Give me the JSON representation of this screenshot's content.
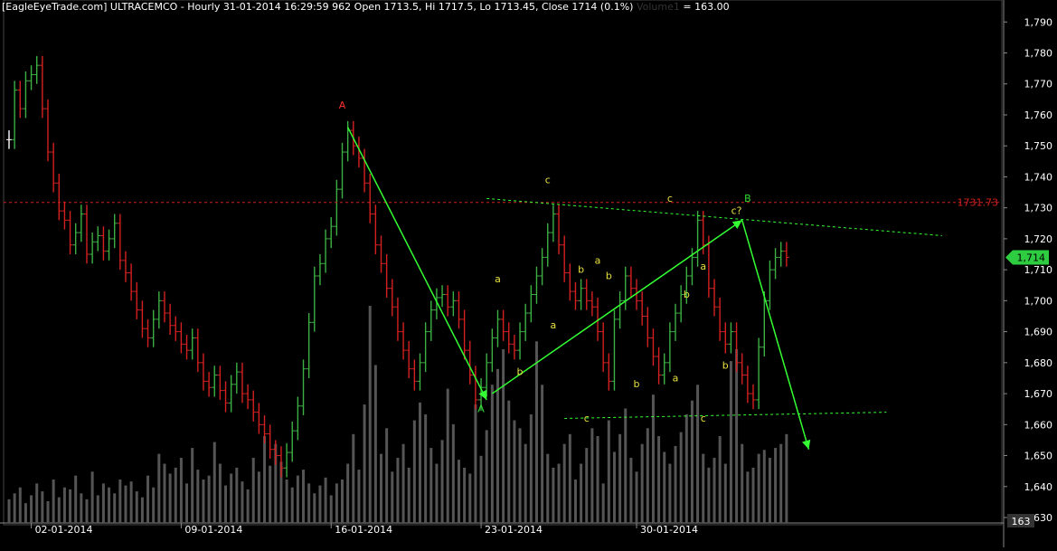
{
  "header": {
    "source": "[EagleEyeTrade.com]",
    "symbol": "ULTRACEMCO",
    "interval": "Hourly",
    "datetime": "31-01-2014 16:29:59 962",
    "ohlc": "Open 1713.5, Hi 1717.5, Lo 1713.45, Close 1714 (0.1%)",
    "volume_label": "Volume1",
    "volume_value": "= 163.00"
  },
  "colors": {
    "background": "#000000",
    "up_bar": "#3cb043",
    "down_bar": "#d42020",
    "neutral_bar": "#ffffff",
    "volume_bar": "#555555",
    "wave_line": "#33ff33",
    "resistance_line": "#d42020",
    "label_yellow": "#e8e040",
    "label_red": "#ff3030",
    "label_green": "#33dd33",
    "axis_text": "#ffffff"
  },
  "chart_data": {
    "type": "line",
    "title": "ULTRACEMCO - Hourly",
    "y_axis_ticks": [
      1790,
      1780,
      1770,
      1760,
      1750,
      1740,
      1730,
      1720,
      1710,
      1700,
      1690,
      1680,
      1670,
      1660,
      1650,
      1640,
      1630
    ],
    "y_tick_labels": [
      "1,790",
      "1,780",
      "1,770",
      "1,760",
      "1,750",
      "1,740",
      "1,730",
      "1,720",
      "1,710",
      "1,700",
      "1,690",
      "1,680",
      "1,670",
      "1,660",
      "1,650",
      "1,640",
      "1,630"
    ],
    "ylim": [
      1630,
      1793
    ],
    "x_tick_labels": [
      "02-01-2014",
      "09-01-2014",
      "16-01-2014",
      "23-01-2014",
      "30-01-2014"
    ],
    "current_price_label": "1,714",
    "volume_label": "163",
    "resistance_level": 1731.73,
    "resistance_label": "1731.73",
    "price_series": [
      1752,
      1768,
      1762,
      1771,
      1773,
      1776,
      1762,
      1748,
      1738,
      1729,
      1726,
      1718,
      1722,
      1728,
      1715,
      1719,
      1721,
      1716,
      1720,
      1725,
      1713,
      1709,
      1703,
      1697,
      1691,
      1688,
      1694,
      1700,
      1696,
      1692,
      1690,
      1686,
      1684,
      1688,
      1680,
      1674,
      1672,
      1676,
      1671,
      1667,
      1673,
      1677,
      1670,
      1668,
      1664,
      1660,
      1657,
      1652,
      1650,
      1646,
      1651,
      1658,
      1666,
      1678,
      1693,
      1708,
      1712,
      1720,
      1724,
      1736,
      1748,
      1755,
      1750,
      1746,
      1738,
      1728,
      1718,
      1712,
      1704,
      1698,
      1690,
      1684,
      1678,
      1674,
      1680,
      1690,
      1697,
      1701,
      1702,
      1698,
      1700,
      1694,
      1684,
      1676,
      1668,
      1672,
      1680,
      1688,
      1694,
      1690,
      1686,
      1684,
      1690,
      1696,
      1702,
      1708,
      1714,
      1722,
      1728,
      1718,
      1709,
      1703,
      1700,
      1704,
      1700,
      1698,
      1690,
      1680,
      1674,
      1694,
      1700,
      1708,
      1704,
      1700,
      1695,
      1688,
      1682,
      1676,
      1680,
      1690,
      1696,
      1702,
      1708,
      1714,
      1726,
      1718,
      1704,
      1698,
      1690,
      1686,
      1690,
      1680,
      1676,
      1670,
      1668,
      1685,
      1700,
      1710,
      1714,
      1716,
      1714
    ],
    "volume_series": [
      12,
      15,
      18,
      10,
      14,
      20,
      16,
      11,
      22,
      13,
      18,
      17,
      24,
      15,
      12,
      26,
      14,
      20,
      18,
      15,
      22,
      19,
      21,
      16,
      13,
      24,
      18,
      35,
      30,
      25,
      28,
      33,
      20,
      38,
      27,
      22,
      24,
      41,
      30,
      19,
      25,
      28,
      21,
      17,
      33,
      26,
      44,
      29,
      40,
      31,
      22,
      18,
      24,
      27,
      20,
      15,
      19,
      23,
      14,
      20,
      22,
      30,
      45,
      27,
      60,
      110,
      80,
      35,
      48,
      26,
      33,
      40,
      28,
      52,
      61,
      55,
      38,
      30,
      42,
      68,
      50,
      32,
      28,
      25,
      60,
      34,
      47,
      70,
      78,
      88,
      62,
      52,
      48,
      40,
      55,
      92,
      70,
      35,
      28,
      30,
      40,
      45,
      22,
      30,
      38,
      48,
      44,
      20,
      52,
      36,
      45,
      58,
      33,
      26,
      40,
      48,
      65,
      44,
      36,
      30,
      39,
      46,
      55,
      62,
      70,
      35,
      28,
      33,
      44,
      30,
      82,
      88,
      40,
      26,
      28,
      35,
      37,
      33,
      38,
      40,
      45
    ],
    "wave_labels": [
      {
        "text": "A",
        "price": 1762,
        "color": "red",
        "index": 60
      },
      {
        "text": "A",
        "price": 1664,
        "color": "green",
        "index": 85
      },
      {
        "text": "c",
        "price": 1738,
        "color": "yellow",
        "index": 97
      },
      {
        "text": "c",
        "price": 1732,
        "color": "yellow",
        "index": 119
      },
      {
        "text": "c?",
        "price": 1728,
        "color": "yellow",
        "index": 131
      },
      {
        "text": "B",
        "price": 1732,
        "color": "green",
        "index": 133
      },
      {
        "text": "a",
        "price": 1706,
        "color": "yellow",
        "index": 88
      },
      {
        "text": "b",
        "price": 1676,
        "color": "yellow",
        "index": 92
      },
      {
        "text": "a",
        "price": 1691,
        "color": "yellow",
        "index": 98
      },
      {
        "text": "b",
        "price": 1709,
        "color": "yellow",
        "index": 103
      },
      {
        "text": "a",
        "price": 1712,
        "color": "yellow",
        "index": 106
      },
      {
        "text": "b",
        "price": 1707,
        "color": "yellow",
        "index": 108
      },
      {
        "text": "c",
        "price": 1661,
        "color": "yellow",
        "index": 104
      },
      {
        "text": "b",
        "price": 1672,
        "color": "yellow",
        "index": 113
      },
      {
        "text": "b",
        "price": 1701,
        "color": "yellow",
        "index": 122
      },
      {
        "text": "a",
        "price": 1710,
        "color": "yellow",
        "index": 125
      },
      {
        "text": "a",
        "price": 1674,
        "color": "yellow",
        "index": 120
      },
      {
        "text": "c",
        "price": 1661,
        "color": "yellow",
        "index": 125
      },
      {
        "text": "b",
        "price": 1678,
        "color": "yellow",
        "index": 129
      }
    ],
    "wave_lines": [
      {
        "from_index": 61,
        "from_price": 1756,
        "to_index": 86,
        "to_price": 1668
      },
      {
        "from_index": 87,
        "from_price": 1670,
        "to_index": 132,
        "to_price": 1726
      },
      {
        "from_index": 132,
        "from_price": 1726,
        "to_index": 144,
        "to_price": 1652
      }
    ],
    "trend_lines": [
      {
        "from_index": 86,
        "from_price": 1733,
        "to_index": 168,
        "to_price": 1721
      },
      {
        "from_index": 100,
        "from_price": 1662,
        "to_index": 158,
        "to_price": 1664
      }
    ]
  }
}
